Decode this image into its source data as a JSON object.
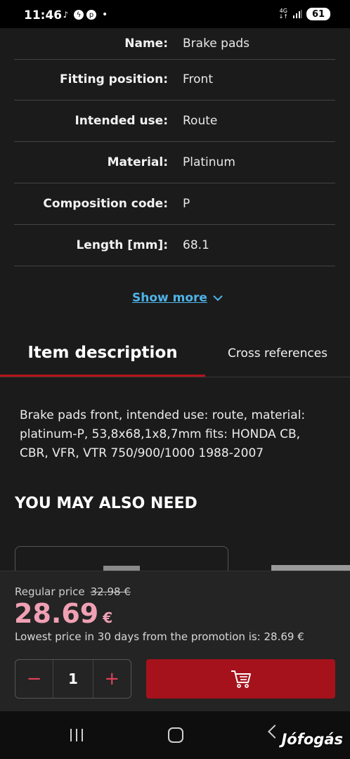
{
  "status_bar": {
    "time": "11:46",
    "network": "4G",
    "battery": "61",
    "notification_icons": [
      "tiktok-icon",
      "messenger-icon",
      "pinterest-icon"
    ],
    "dot": "•"
  },
  "specs": [
    {
      "label": "Name:",
      "value": "Brake pads"
    },
    {
      "label": "Fitting position:",
      "value": "Front"
    },
    {
      "label": "Intended use:",
      "value": "Route"
    },
    {
      "label": "Material:",
      "value": "Platinum"
    },
    {
      "label": "Composition code:",
      "value": "P"
    },
    {
      "label": "Length [mm]:",
      "value": "68.1"
    }
  ],
  "show_more": "Show more",
  "tabs": {
    "active": "Item description",
    "inactive": "Cross references"
  },
  "description": "Brake pads front, intended use: route, material: platinum-P, 53,8x68,1x8,7mm fits: HONDA CB, CBR, VFR, VTR 750/900/1000 1988-2007",
  "also_need_title": "YOU MAY ALSO NEED",
  "price": {
    "regular_label": "Regular price",
    "regular_value": "32.98 €",
    "current_amount": "28.69",
    "currency": "€",
    "lowest_note": "Lowest price in 30 days from the promotion is: 28.69 €"
  },
  "quantity": {
    "minus": "−",
    "value": "1",
    "plus": "+"
  },
  "watermark": "Jófogás",
  "colors": {
    "accent": "#a5121b",
    "price": "#f0a0b4",
    "link": "#4fb3e8",
    "background": "#1b1b1b"
  }
}
